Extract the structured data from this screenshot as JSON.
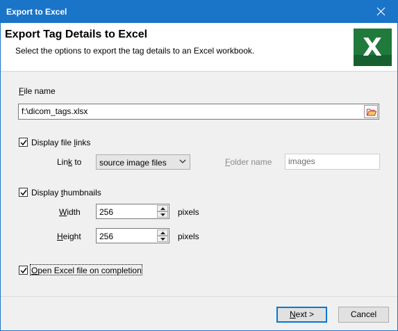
{
  "window": {
    "title": "Export to Excel"
  },
  "header": {
    "title": "Export Tag Details to Excel",
    "subtitle": "Select the options to export the tag details to an Excel workbook.",
    "logo_letter": "X"
  },
  "file_name": {
    "label_prefix": "",
    "label_accel": "F",
    "label_rest": "ile name",
    "value": "f:\\dicom_tags.xlsx"
  },
  "display_file_links": {
    "checked": true,
    "label_prefix": "Display file ",
    "label_accel": "l",
    "label_rest": "inks",
    "link_to_prefix": "Lin",
    "link_to_accel": "k",
    "link_to_rest": " to",
    "link_to_value": "source image files",
    "folder_prefix": "",
    "folder_accel": "F",
    "folder_rest": "older name",
    "folder_value": "images"
  },
  "display_thumbnails": {
    "checked": true,
    "label_prefix": "Display ",
    "label_accel": "t",
    "label_rest": "humbnails",
    "width_prefix": "",
    "width_accel": "W",
    "width_rest": "idth",
    "width_value": "256",
    "height_prefix": "",
    "height_accel": "H",
    "height_rest": "eight",
    "height_value": "256",
    "units": "pixels"
  },
  "open_on_completion": {
    "checked": true,
    "label_prefix": "",
    "label_accel": "O",
    "label_rest": "pen Excel file on completion"
  },
  "buttons": {
    "next_prefix": "",
    "next_accel": "N",
    "next_rest": "ext >",
    "cancel": "Cancel"
  },
  "colors": {
    "titlebar": "#1a74c8",
    "excel_green": "#1f7a3c",
    "default_button_border": "#0078d7"
  }
}
